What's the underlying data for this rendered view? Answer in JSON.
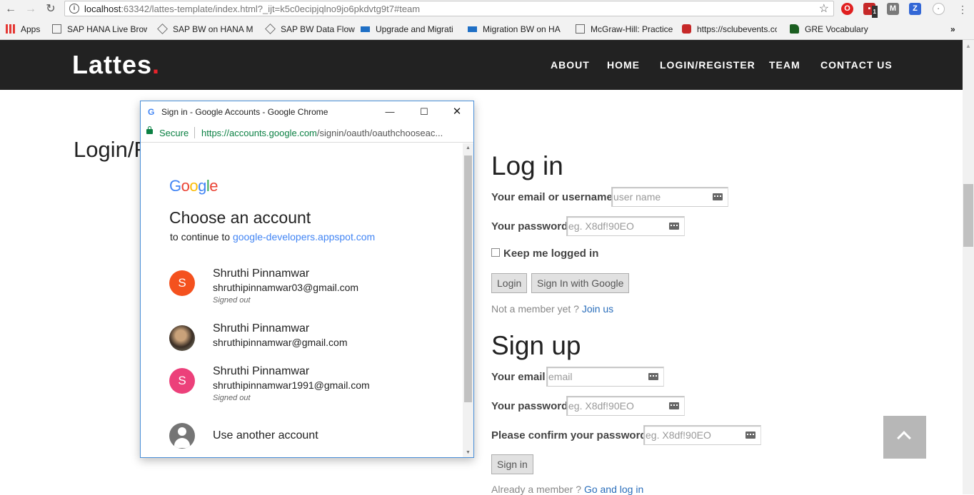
{
  "browser": {
    "url_host": "localhost",
    "url_rest": ":63342/lattes-template/index.html?_ijt=k5c0ecipjqlno9jo6pkdvtg9t7#team",
    "bookmarks": [
      {
        "label": "Apps",
        "icon": "apps-grid-icon"
      },
      {
        "label": "SAP HANA Live Brow",
        "icon": "page-icon"
      },
      {
        "label": "SAP BW on HANA Mi",
        "icon": "diamond-icon"
      },
      {
        "label": "SAP BW Data Flow",
        "icon": "diamond-icon"
      },
      {
        "label": "Upgrade and Migrati",
        "icon": "sap-icon"
      },
      {
        "label": "Migration BW on HA",
        "icon": "sap-icon"
      },
      {
        "label": "McGraw-Hill: Practice",
        "icon": "page-icon"
      },
      {
        "label": "https://sclubevents.cc",
        "icon": "spider-icon"
      },
      {
        "label": "GRE Vocabulary",
        "icon": "spartan-icon"
      }
    ],
    "overflow": "»",
    "ext_badge": "1"
  },
  "site": {
    "logo": "Lattes",
    "logo_dot": ".",
    "menu": [
      "ABOUT",
      "HOME",
      "LOGIN/REGISTER",
      "TEAM",
      "CONTACT US"
    ],
    "page_heading": "Login/R"
  },
  "login": {
    "title": "Log in",
    "email_label": "Your email or username",
    "email_placeholder": "user name",
    "password_label": "Your password",
    "password_placeholder": "eg. X8df!90EO",
    "keep_logged": "Keep me logged in",
    "login_btn": "Login",
    "google_btn": "Sign In with Google",
    "not_member": "Not a member yet ?",
    "join": "Join us"
  },
  "signup": {
    "title": "Sign up",
    "email_label": "Your email",
    "email_placeholder": "email",
    "password_label": "Your password",
    "password_placeholder": "eg. X8df!90EO",
    "confirm_label": "Please confirm your password",
    "confirm_placeholder": "eg. X8df!90EO",
    "signin_btn": "Sign in",
    "already": "Already a member ?",
    "go_login": "Go and log in"
  },
  "popup": {
    "window_title": "Sign in - Google Accounts - Google Chrome",
    "secure": "Secure",
    "url_host": "https://accounts.google.com",
    "url_rest": "/signin/oauth/oauthchooseac...",
    "heading": "Choose an account",
    "continue_prefix": "to continue to ",
    "continue_link": "google-developers.appspot.com",
    "accounts": [
      {
        "initial": "S",
        "name": "Shruthi Pinnamwar",
        "email": "shruthipinnamwar03@gmail.com",
        "status": "Signed out",
        "color": "#f4511e"
      },
      {
        "initial": "",
        "name": "Shruthi Pinnamwar",
        "email": "shruthipinnamwar@gmail.com",
        "status": "",
        "color": "#5a4a3a"
      },
      {
        "initial": "S",
        "name": "Shruthi Pinnamwar",
        "email": "shruthipinnamwar1991@gmail.com",
        "status": "Signed out",
        "color": "#ec407a"
      }
    ],
    "another": "Use another account"
  },
  "colors": {
    "nav_bg": "#222222",
    "logo_dot": "#e8232b",
    "link": "#2a6ebb",
    "google_blue": "#4285f4",
    "secure_green": "#0b8043"
  }
}
